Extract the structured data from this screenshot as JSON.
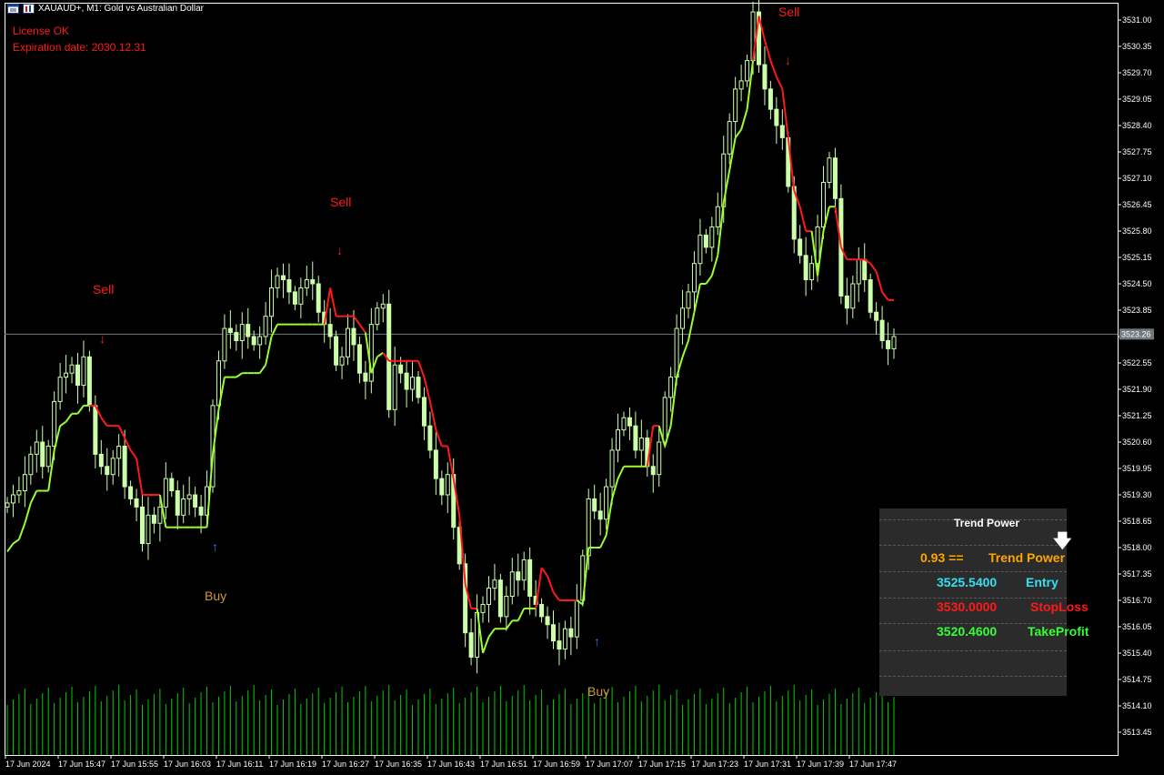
{
  "window": {
    "title": "XAUAUD+, M1:  Gold vs Australian Dollar"
  },
  "license": {
    "status": "License OK",
    "expiration": "Expiration date: 2030.12.31"
  },
  "current_price": "3523.26",
  "signals": [
    {
      "label": "Sell",
      "type": "sell"
    },
    {
      "label": "Sell",
      "type": "sell"
    },
    {
      "label": "Sell",
      "type": "sell"
    },
    {
      "label": "Buy",
      "type": "buy"
    },
    {
      "label": "Buy",
      "type": "buy"
    }
  ],
  "panel": {
    "title": "Trend Power",
    "arrow_icon": "down-arrow-icon",
    "rows": [
      {
        "value": "0.93  ==",
        "label": "Trend Power",
        "color": "#ffa500"
      },
      {
        "value": "3525.5400",
        "label": "Entry",
        "color": "#33e0f0"
      },
      {
        "value": "3530.0000",
        "label": "StopLoss",
        "color": "#ff1a1a"
      },
      {
        "value": "3520.4600",
        "label": "TakeProfit",
        "color": "#33ff33"
      }
    ]
  },
  "colors": {
    "background": "#000000",
    "candle": "#ccffaa",
    "up_trend_line": "#99ff33",
    "down_trend_line": "#ff1a1a",
    "volume": "#00cc00",
    "buy_arrow": "#3377ff",
    "buy_text": "#cc9933",
    "sell": "#ff1a1a"
  },
  "chart_data": {
    "type": "candlestick",
    "symbol": "XAUAUD+",
    "timeframe": "M1",
    "y_ticks": [
      "3531.00",
      "3530.35",
      "3529.70",
      "3529.05",
      "3528.40",
      "3527.75",
      "3527.10",
      "3526.45",
      "3525.80",
      "3525.15",
      "3524.50",
      "3523.85",
      "3523.20",
      "3522.55",
      "3521.90",
      "3521.25",
      "3520.60",
      "3519.95",
      "3519.30",
      "3518.65",
      "3518.00",
      "3517.35",
      "3516.70",
      "3516.05",
      "3515.40",
      "3514.75",
      "3514.10",
      "3513.45"
    ],
    "x_ticks": [
      "17 Jun 2024",
      "17 Jun 15:47",
      "17 Jun 15:55",
      "17 Jun 16:03",
      "17 Jun 16:11",
      "17 Jun 16:19",
      "17 Jun 16:27",
      "17 Jun 16:35",
      "17 Jun 16:43",
      "17 Jun 16:51",
      "17 Jun 16:59",
      "17 Jun 17:07",
      "17 Jun 17:15",
      "17 Jun 17:23",
      "17 Jun 17:31",
      "17 Jun 17:39",
      "17 Jun 17:47"
    ],
    "ylim": [
      3512.9,
      3531.3
    ],
    "close_series": [
      3519.1,
      3519.3,
      3519.4,
      3519.8,
      3520.3,
      3520.6,
      3520.0,
      3520.5,
      3521.6,
      3522.2,
      3522.3,
      3522.5,
      3522.0,
      3522.7,
      3521.5,
      3520.3,
      3520.0,
      3519.8,
      3520.2,
      3520.5,
      3519.5,
      3519.2,
      3519.0,
      3518.1,
      3518.8,
      3518.6,
      3519.0,
      3519.7,
      3519.4,
      3518.8,
      3519.2,
      3519.3,
      3519.0,
      3518.8,
      3519.5,
      3521.5,
      3522.6,
      3523.4,
      3523.3,
      3523.1,
      3523.5,
      3523.2,
      3523.0,
      3523.2,
      3523.7,
      3524.4,
      3524.7,
      3524.6,
      3524.3,
      3524.0,
      3524.4,
      3524.6,
      3524.5,
      3523.8,
      3523.5,
      3523.2,
      3522.5,
      3522.7,
      3523.4,
      3523.0,
      3522.3,
      3522.1,
      3523.5,
      3523.9,
      3524.0,
      3521.4,
      3522.5,
      3522.3,
      3521.9,
      3522.2,
      3521.7,
      3521.0,
      3520.4,
      3519.7,
      3519.3,
      3519.8,
      3518.5,
      3517.6,
      3515.9,
      3515.3,
      3516.4,
      3516.6,
      3517.0,
      3517.2,
      3516.3,
      3516.8,
      3517.4,
      3517.2,
      3517.7,
      3516.8,
      3516.6,
      3516.3,
      3516.1,
      3515.7,
      3515.5,
      3516.0,
      3515.8,
      3516.7,
      3517.8,
      3519.2,
      3518.9,
      3518.7,
      3519.5,
      3520.4,
      3520.9,
      3521.2,
      3521.0,
      3520.4,
      3520.7,
      3520.0,
      3519.8,
      3520.6,
      3521.7,
      3522.2,
      3523.4,
      3523.9,
      3524.3,
      3525.0,
      3525.7,
      3525.4,
      3525.9,
      3526.4,
      3527.7,
      3528.5,
      3529.3,
      3529.5,
      3530.0,
      3531.2,
      3529.9,
      3529.3,
      3528.8,
      3528.4,
      3528.1,
      3526.9,
      3525.6,
      3525.2,
      3524.6,
      3525.0,
      3525.9,
      3527.0,
      3527.6,
      3526.6,
      3524.2,
      3523.9,
      3524.5,
      3525.1,
      3524.6,
      3523.8,
      3523.6,
      3523.1,
      3522.9,
      3523.2
    ]
  }
}
